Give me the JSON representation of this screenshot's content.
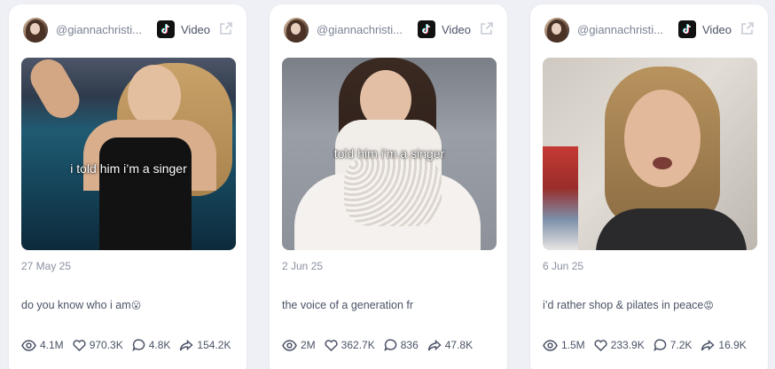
{
  "cards": [
    {
      "username": "@giannachristi...",
      "platform_icon": "tiktok-icon",
      "type_label": "Video",
      "overlay_text": "i told him i’m a singer",
      "date": "27 May 25",
      "caption": "do you know who i am",
      "caption_emoji": "😮",
      "stats": {
        "views": "4.1M",
        "likes": "970.3K",
        "comments": "4.8K",
        "shares": "154.2K"
      }
    },
    {
      "username": "@giannachristi...",
      "platform_icon": "tiktok-icon",
      "type_label": "Video",
      "overlay_text": "told him i’m a singer",
      "date": "2 Jun 25",
      "caption": "the voice of a generation fr",
      "caption_emoji": "",
      "stats": {
        "views": "2M",
        "likes": "362.7K",
        "comments": "836",
        "shares": "47.8K"
      }
    },
    {
      "username": "@giannachristi...",
      "platform_icon": "tiktok-icon",
      "type_label": "Video",
      "overlay_text": "",
      "date": "6 Jun 25",
      "caption": "i’d rather shop & pilates in peace",
      "caption_emoji": "😡",
      "stats": {
        "views": "1.5M",
        "likes": "233.9K",
        "comments": "7.2K",
        "shares": "16.9K"
      }
    }
  ],
  "icons": {
    "views": "eye-icon",
    "likes": "heart-icon",
    "comments": "comment-icon",
    "shares": "share-icon",
    "open": "external-link-icon"
  }
}
